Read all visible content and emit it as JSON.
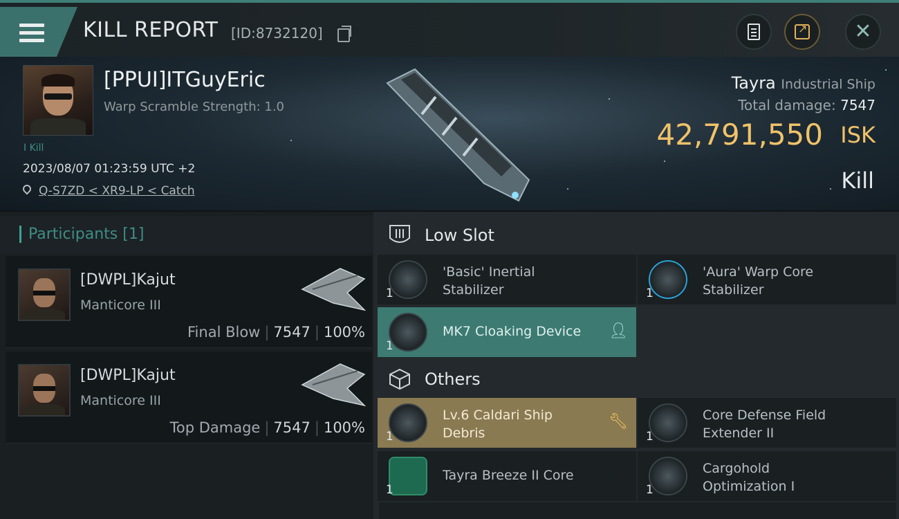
{
  "header": {
    "title": "KILL REPORT",
    "report_id": "[ID:8732120]",
    "icons": [
      "menu-icon",
      "copy-icon",
      "clipboard-icon",
      "share-icon",
      "close-icon"
    ]
  },
  "victim": {
    "pilot": "[PPUI]ITGuyEric",
    "warp_scramble": "Warp Scramble Strength: 1.0",
    "tag": "I Kill",
    "datetime": "2023/08/07 01:23:59 UTC +2",
    "location": "Q-S7ZD < XR9-LP < Catch",
    "ship_name": "Tayra",
    "ship_class": "Industrial Ship",
    "total_damage_label": "Total damage:",
    "total_damage": "7547",
    "isk_value": "42,791,550",
    "isk_unit": "ISK",
    "result": "Kill"
  },
  "participants": {
    "title": "Participants",
    "count": "[1]",
    "rows": [
      {
        "name": "[DWPL]Kajut",
        "ship": "Manticore III",
        "role": "Final Blow",
        "damage": "7547",
        "percent": "100%"
      },
      {
        "name": "[DWPL]Kajut",
        "ship": "Manticore III",
        "role": "Top Damage",
        "damage": "7547",
        "percent": "100%"
      }
    ]
  },
  "low_slot": {
    "title": "Low Slot",
    "items": [
      {
        "name": "'Basic' Inertial Stabilizer",
        "qty": "1"
      },
      {
        "name": "'Aura' Warp Core Stabilizer",
        "qty": "1"
      },
      {
        "name": "MK7 Cloaking Device",
        "qty": "1"
      }
    ]
  },
  "others": {
    "title": "Others",
    "items": [
      {
        "name": "Lv.6 Caldari Ship Debris",
        "qty": "1"
      },
      {
        "name": "Core Defense Field Extender II",
        "qty": "1"
      },
      {
        "name": "Tayra Breeze II Core",
        "qty": "1"
      },
      {
        "name": "Cargohold Optimization I",
        "qty": "1"
      }
    ]
  },
  "colors": {
    "accent": "#3f8d85",
    "isk": "#f0c26a",
    "cloak_bg": "#3c7a72",
    "debris_bg": "#8a7a52"
  }
}
